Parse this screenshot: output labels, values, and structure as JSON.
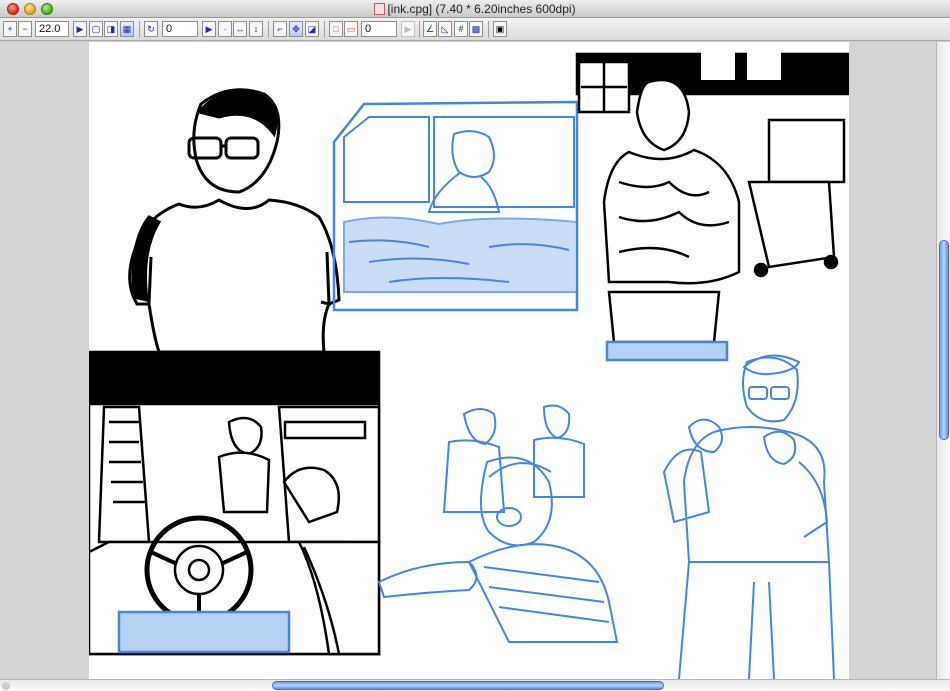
{
  "window": {
    "title": "[ink.cpg] (7.40 * 6.20inches 600dpi)"
  },
  "toolbar": {
    "zoom_value": "22.0",
    "rotate_value": "0",
    "layer_value": "0"
  },
  "icons": {
    "close": "close-button",
    "minimize": "minimize-button",
    "zoom": "zoom-button",
    "document": "document-icon"
  },
  "colors": {
    "ink": "#000000",
    "pencil_blue": "#4a86d8",
    "light_blue": "#b6d0f2",
    "scroll_thumb": "#6fa0e8"
  }
}
